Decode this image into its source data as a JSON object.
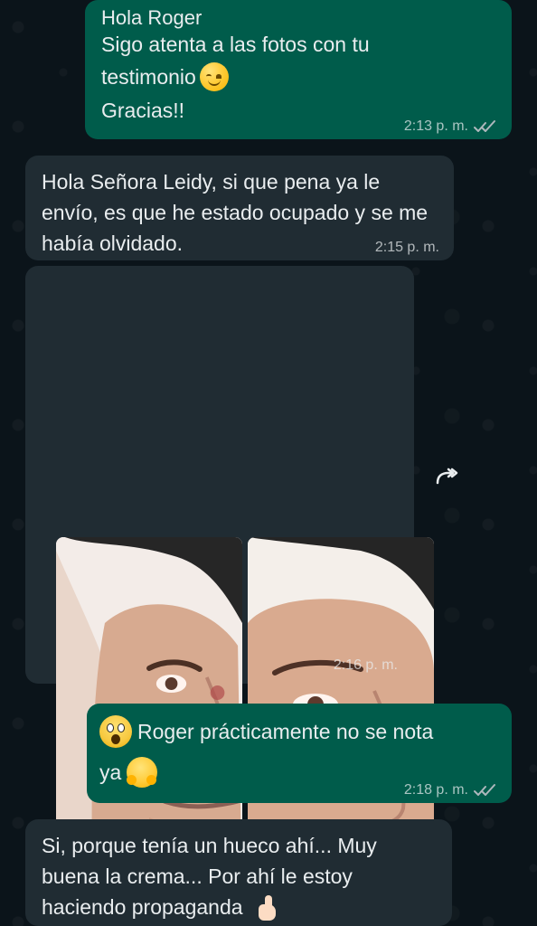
{
  "chat": {
    "messages": [
      {
        "lines": [
          "Hola Roger",
          "Sigo atenta a las fotos con tu",
          "testimonio",
          "Gracias!!"
        ],
        "time": "2:13 p. m."
      },
      {
        "text": "Hola Señora Leidy, si que pena ya le envío, es que he estado ocupado y se me había olvidado.",
        "time": "2:15 p. m."
      },
      {
        "time": "2:16 p. m."
      },
      {
        "lines": [
          "Roger prácticamente no se nota",
          "ya"
        ],
        "time": "2:18 p. m."
      },
      {
        "text": "Si, porque tenía un hueco ahí... Muy buena la crema... Por ahí le estoy haciendo propaganda"
      }
    ]
  },
  "icons": {
    "smile_emoji": "smiling-face-emoji",
    "scream_emoji": "face-screaming-emoji",
    "hug_emoji": "hugging-face-emoji",
    "thumb_emoji": "thumbs-up-emoji",
    "forward": "forward-icon",
    "read_receipt": "double-check-icon"
  },
  "colors": {
    "background": "#0b141a",
    "outgoing_bubble": "#005c4b",
    "incoming_bubble": "#202c33",
    "text": "#e9edef",
    "meta": "#aeb8bd"
  }
}
